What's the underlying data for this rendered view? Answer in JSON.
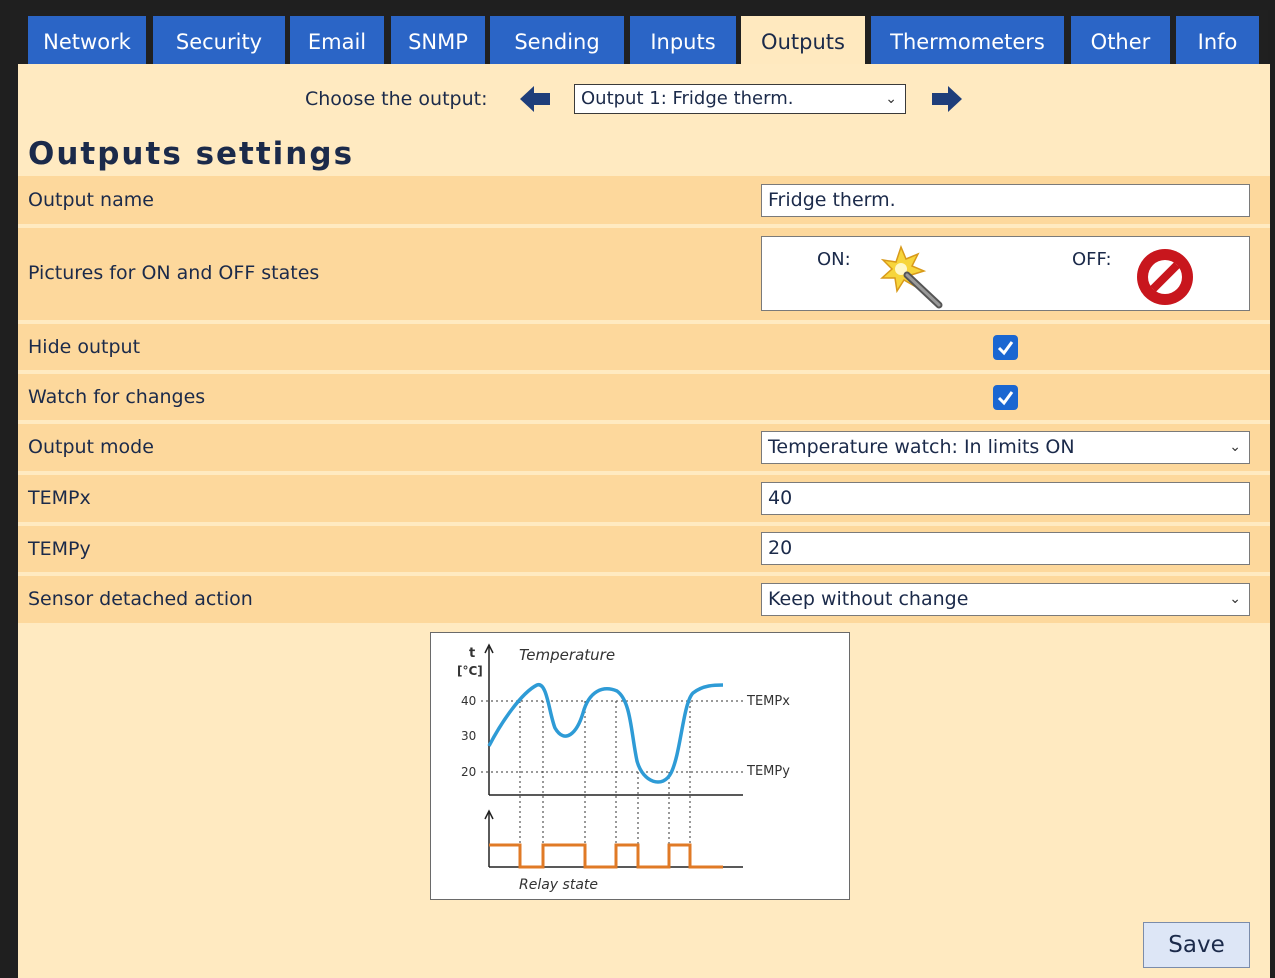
{
  "tabs": [
    {
      "label": "Network"
    },
    {
      "label": "Security"
    },
    {
      "label": "Email"
    },
    {
      "label": "SNMP"
    },
    {
      "label": "Sending"
    },
    {
      "label": "Inputs"
    },
    {
      "label": "Outputs",
      "active": true
    },
    {
      "label": "Thermometers"
    },
    {
      "label": "Other"
    },
    {
      "label": "Info"
    }
  ],
  "chooser": {
    "label": "Choose the output:",
    "selected": "Output 1: Fridge therm.",
    "prev_icon": "arrow-left-icon",
    "next_icon": "arrow-right-icon"
  },
  "page_title": "Outputs settings",
  "fields": {
    "output_name": {
      "label": "Output name",
      "value": "Fridge therm."
    },
    "pictures": {
      "label": "Pictures for ON and OFF states",
      "on_label": "ON:",
      "off_label": "OFF:",
      "on_icon": "magic-wand-icon",
      "off_icon": "no-entry-icon"
    },
    "hide_output": {
      "label": "Hide output",
      "checked": true
    },
    "watch_changes": {
      "label": "Watch for changes",
      "checked": true
    },
    "output_mode": {
      "label": "Output mode",
      "value": "Temperature watch: In limits ON"
    },
    "tempx": {
      "label": "TEMPx",
      "value": "40"
    },
    "tempy": {
      "label": "TEMPy",
      "value": "20"
    },
    "sensor_detached": {
      "label": "Sensor detached action",
      "value": "Keep without change"
    }
  },
  "diagram": {
    "axis_t": "t",
    "axis_unit": "[°C]",
    "title": "Temperature",
    "tick_40": "40",
    "tick_30": "30",
    "tick_20": "20",
    "tempx_label": "TEMPx",
    "tempy_label": "TEMPy",
    "relay_label": "Relay state",
    "curve_color": "#2e9bd6",
    "relay_color": "#e07a26"
  },
  "save_label": "Save",
  "colors": {
    "tab_bg": "#2b65c6",
    "panel_bg": "#ffeac1",
    "row_bg": "#fdd89c",
    "checkbox": "#1a66d1"
  }
}
